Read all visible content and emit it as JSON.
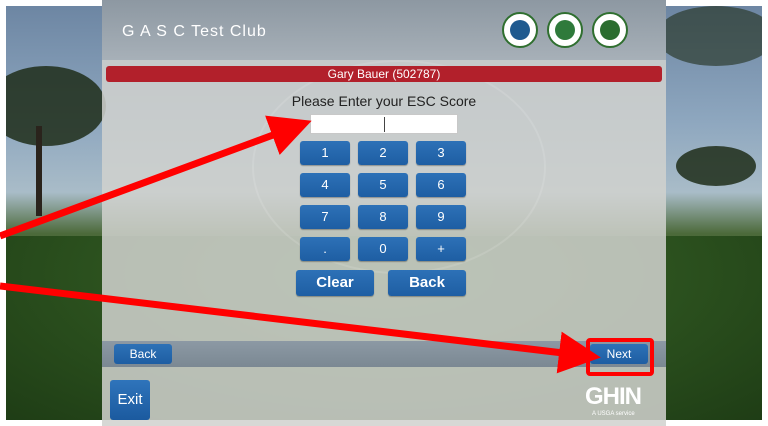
{
  "header": {
    "club_name": "G A S C Test Club",
    "logos": [
      "association-seal-1-icon",
      "association-seal-2-icon",
      "association-seal-3-icon"
    ]
  },
  "player": {
    "name_line": "Gary Bauer (502787)"
  },
  "score_entry": {
    "prompt": "Please Enter your ESC Score",
    "value": ""
  },
  "keypad": {
    "keys": [
      "1",
      "2",
      "3",
      "4",
      "5",
      "6",
      "7",
      "8",
      "9",
      ".",
      "0",
      "+"
    ],
    "clear_label": "Clear",
    "back_label": "Back"
  },
  "nav": {
    "back_label": "Back",
    "next_label": "Next",
    "exit_label": "Exit"
  },
  "brand": {
    "name": "GHIN",
    "sub": "A USGA service"
  },
  "colors": {
    "accent_blue": "#1e5ea3",
    "name_bar_red": "#b2202b",
    "annotation_red": "#ff0000"
  }
}
